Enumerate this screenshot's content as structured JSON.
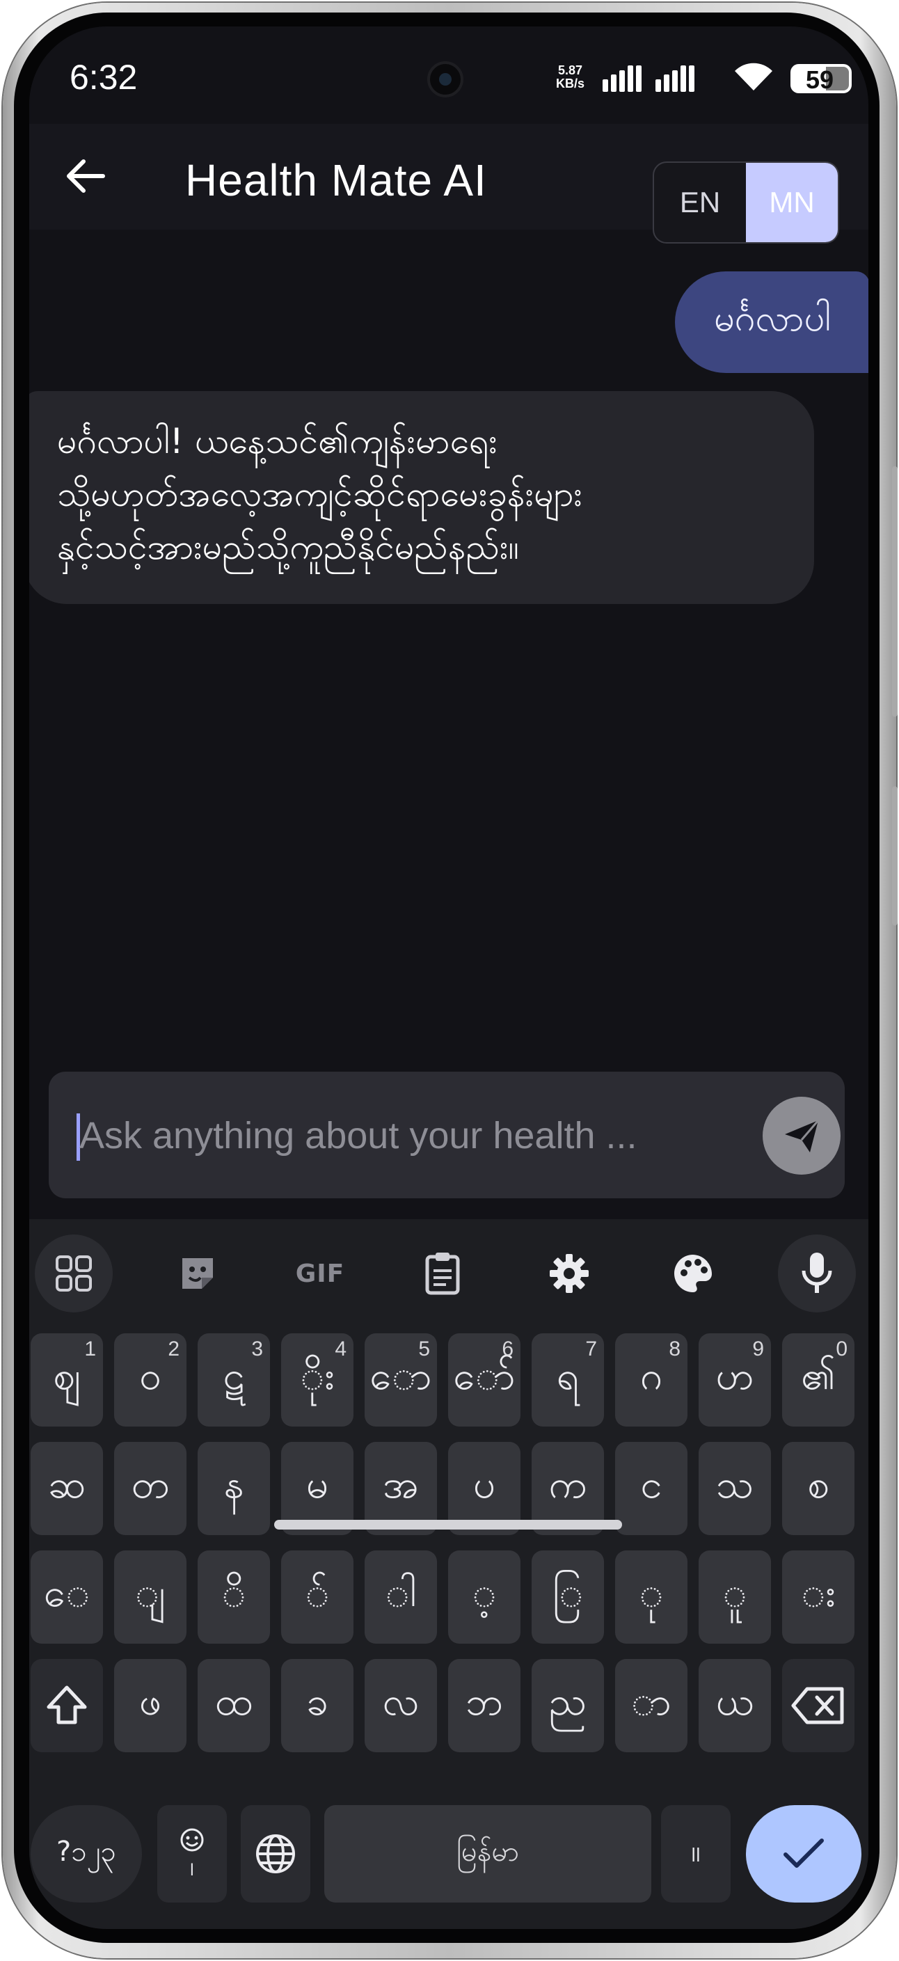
{
  "status_bar": {
    "time": "6:32",
    "net_speed_value": "5.87",
    "net_speed_unit": "KB/s",
    "battery": "59",
    "battery_level": 0.59
  },
  "header": {
    "title": "Health Mate AI",
    "lang_en": "EN",
    "lang_mn": "MN",
    "active_lang": "MN"
  },
  "chat": {
    "user_message": "မင်္ဂလာပါ",
    "bot_message_lines": [
      "မင်္ဂလာပါ! ယနေ့သင်၏ကျန်းမာရေး",
      "သို့မဟုတ်အလေ့အကျင့်ဆိုင်ရာမေးခွန်းများ",
      "နှင့်သင့်အားမည်သို့ကူညီနိုင်မည်နည်း။"
    ]
  },
  "composer": {
    "placeholder": "Ask anything about your health ..."
  },
  "keyboard": {
    "toolbar": [
      "apps-icon",
      "sticker-icon",
      "gif-icon",
      "clipboard-icon",
      "settings-icon",
      "palette-icon",
      "mic-icon"
    ],
    "gif_label": "GIF",
    "row1": [
      {
        "key": "ဈ",
        "hint": "1"
      },
      {
        "key": "ဝ",
        "hint": "2"
      },
      {
        "key": "ဋ",
        "hint": "3"
      },
      {
        "key": "ိုး",
        "hint": "4"
      },
      {
        "key": "ော",
        "hint": "5"
      },
      {
        "key": "ော်",
        "hint": "6"
      },
      {
        "key": "ရ",
        "hint": "7"
      },
      {
        "key": "ဂ",
        "hint": "8"
      },
      {
        "key": "ဟ",
        "hint": "9"
      },
      {
        "key": "၏",
        "hint": "0"
      }
    ],
    "row2": [
      "ဆ",
      "တ",
      "န",
      "မ",
      "အ",
      "ပ",
      "က",
      "င",
      "သ",
      "စ"
    ],
    "row3": [
      "ေ",
      "ျ",
      "ိ",
      "်",
      "ါ",
      "့",
      "ြ",
      "ု",
      "ူ",
      "း"
    ],
    "row4": [
      "ဖ",
      "ထ",
      "ခ",
      "လ",
      "ဘ",
      "ည",
      "ာ",
      "ယ"
    ],
    "symbols_key": "?၁၂၃",
    "emoji_punct": "၊",
    "space_label": "မြန်မာ",
    "period_key": "။"
  },
  "colors": {
    "background": "#121217",
    "header": "#17171d",
    "user_bubble": "#3d4680",
    "bot_bubble": "#26262c",
    "accent": "#c6cbff",
    "enter_key": "#aec6ff"
  }
}
